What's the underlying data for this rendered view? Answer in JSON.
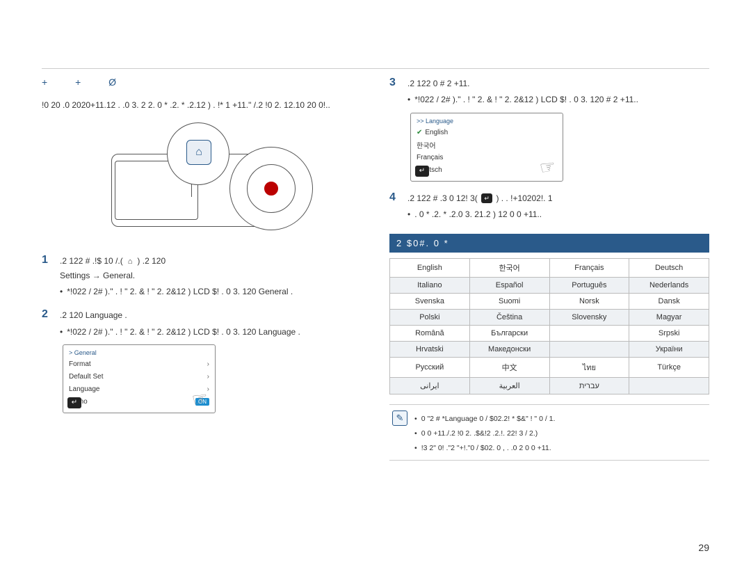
{
  "title_raw": "+      +      Ø",
  "left": {
    "intro": "!0 20 .0   2020+11.12   . .0 3.   2 2. 0 * .2. * .2.12 ) . !* 1 +11.\" /.2 !0 2. 12.10  20  0!..",
    "step1": {
      "num": "1",
      "text_a": ".2 122  #  .!$  10 /.(",
      "text_b": ")  .2 120",
      "line2_a": "Settings",
      "line2_b": "General",
      "line2_sep": " → ",
      "bullet": "*!022 / 2# ).\" . ! \" 2. & ! \" 2. 2&12 ) LCD $! . 0 3. 120 General ."
    },
    "step2": {
      "num": "2",
      "text": ".2 120 Language .",
      "bullet": "*!022 / 2# ).\" . ! \" 2. & ! \" 2. 2&12 ) LCD $! . 0 3. 120 Language ."
    },
    "lcd_general": {
      "crumb": "> General",
      "rows": [
        "Format",
        "Default Set",
        "Language",
        "Demo"
      ],
      "on": "ON"
    }
  },
  "right": {
    "step3": {
      "num": "3",
      "text": ".2 122  0  # 2  +11.",
      "bullet": "*!022 / 2# ).\" . ! \" 2. & ! \" 2. 2&12 ) LCD $! . 0 3. 120  # 2  +11.."
    },
    "lcd_lang": {
      "crumb": ">> Language",
      "rows": [
        "English",
        "한국어",
        "Français",
        "Deutsch"
      ]
    },
    "step4": {
      "num": "4",
      "text_a": ".2 122  #  .3 0 12! 3(",
      "text_b": ") . . !+10202!. 1",
      "bullet": ". 0 * .2. * .2.0 3.  21.2  ) 12 0  0  +11.."
    },
    "bar": "2  $0#.  0 *",
    "lang_table": [
      [
        "English",
        "한국어",
        "Français",
        "Deutsch"
      ],
      [
        "Italiano",
        "Español",
        "Português",
        "Nederlands"
      ],
      [
        "Svenska",
        "Suomi",
        "Norsk",
        "Dansk"
      ],
      [
        "Polski",
        "Čeština",
        "Slovensky",
        "Magyar"
      ],
      [
        "Română",
        "Български",
        "",
        "Srpski"
      ],
      [
        "Hrvatski",
        "Македонски",
        "",
        "України"
      ],
      [
        "Русский",
        "中文",
        "ไทย",
        "Türkçe"
      ],
      [
        "ایرانی",
        "العربية",
        "עברית",
        ""
      ]
    ],
    "notes": [
      "0   \"2 # *Language 0 / $02.2!   * $&\" ! \" 0 / 1.",
      "0 0   +11./.2 !0 2. .$&!2  .2.!. 22! 3 / 2.)",
      "!3 2\" 0!  .\"2 \"+!.\"0 / $02.   0 , . .0 2  0 0  +11."
    ]
  },
  "icons": {
    "home": "⌂",
    "back": "↵",
    "hand": "☞",
    "check": "✔",
    "note": "✎"
  },
  "page_number": "29"
}
